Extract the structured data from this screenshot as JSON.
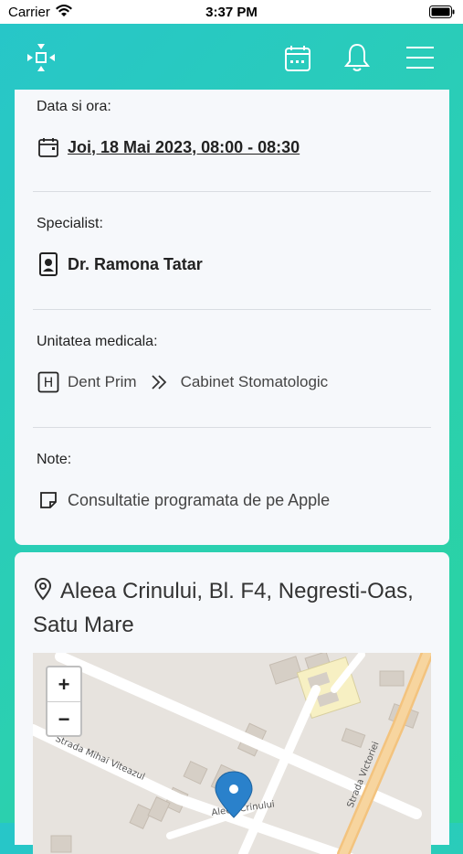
{
  "status_bar": {
    "carrier": "Carrier",
    "time": "3:37 PM"
  },
  "appointment": {
    "datetime_label": "Data si ora:",
    "datetime_value": "Joi, 18 Mai 2023, 08:00 - 08:30",
    "specialist_label": "Specialist:",
    "specialist_value": "Dr. Ramona Tatar",
    "unit_label": "Unitatea medicala:",
    "unit_name": "Dent Prim",
    "unit_type": "Cabinet Stomatologic",
    "notes_label": "Note:",
    "notes_value": "Consultatie programata de pe Apple"
  },
  "location": {
    "address": "Aleea Crinului, Bl. F4, Negresti-Oas, Satu Mare",
    "zoom_in": "+",
    "zoom_out": "−",
    "streets": [
      "Strada Mihai Viteazul",
      "Strada Victoriei",
      "Aleea Crinului"
    ]
  },
  "colors": {
    "header_gradient_start": "#27c6c9",
    "header_gradient_end": "#2ad39e",
    "card_bg": "#f6f8fb",
    "marker": "#2a81cb"
  }
}
